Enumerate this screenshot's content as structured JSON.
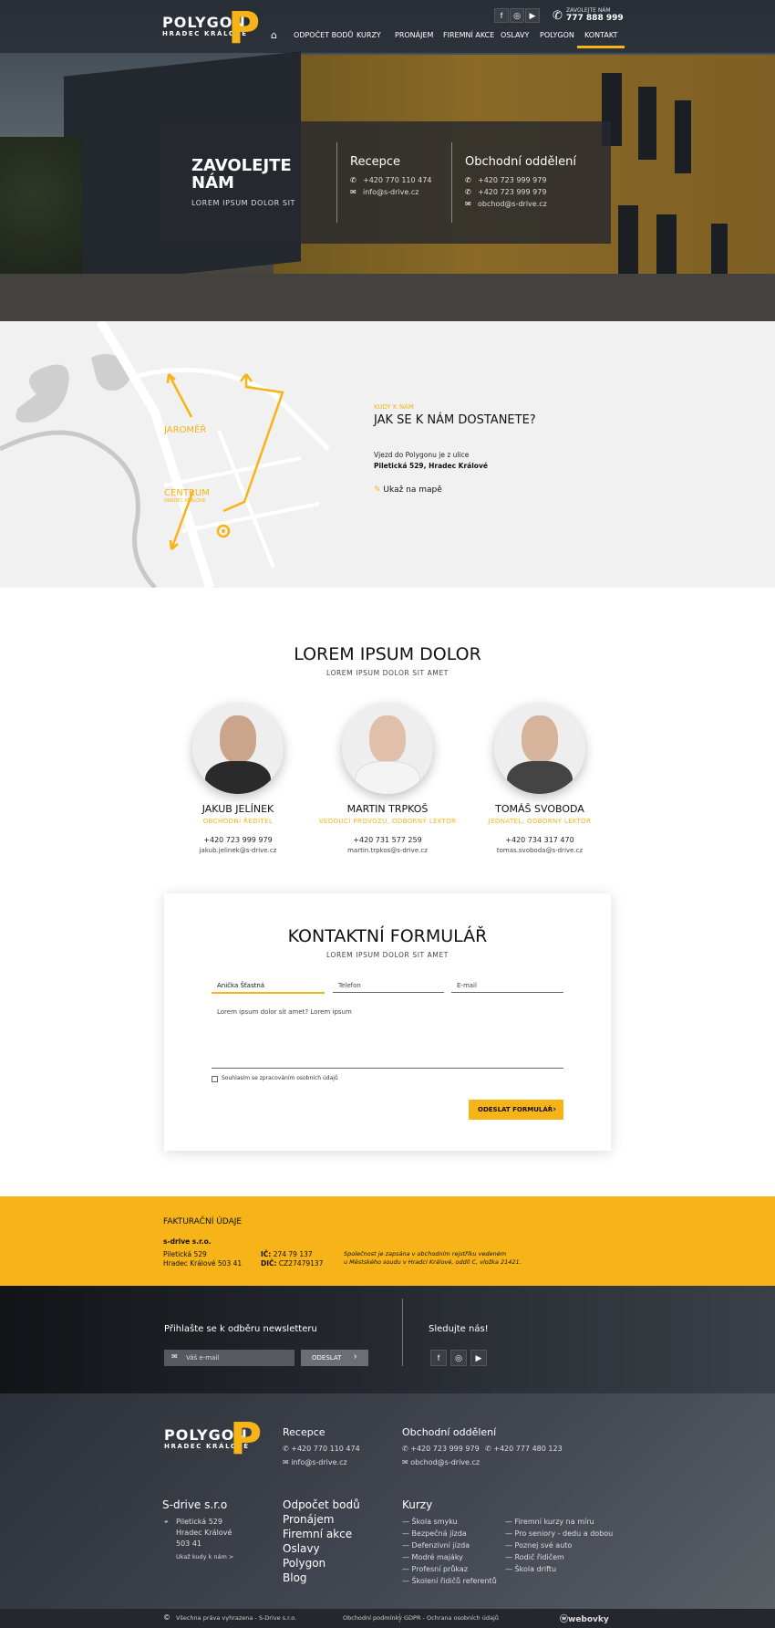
{
  "header": {
    "logo_main": "POLYGON",
    "logo_sub": "HRADEC KRÁLOVÉ",
    "call_label": "ZAVOLEJTE NÁM",
    "call_number": "777 888 999",
    "nav": [
      "ODPOČET BODŮ",
      "KURZY",
      "PRONÁJEM",
      "FIREMNÍ AKCE",
      "OSLAVY",
      "POLYGON",
      "KONTAKT"
    ],
    "social": [
      "facebook-icon",
      "instagram-icon",
      "youtube-icon"
    ]
  },
  "hero": {
    "title": "ZAVOLEJTE NÁM",
    "subtitle": "LOREM IPSUM DOLOR SIT",
    "reception": {
      "heading": "Recepce",
      "phone": "+420 770 110 474",
      "email": "info@s-drive.cz"
    },
    "sales": {
      "heading": "Obchodní oddělení",
      "phone1": "+420 723 999 979",
      "phone2": "+420 723 999 979",
      "email": "obchod@s-drive.cz"
    }
  },
  "map": {
    "label_jaromer": "JAROMĚŘ",
    "label_centrum": "CENTRUM",
    "label_centrum_sub": "HRADEC KRÁLOVÉ",
    "kicker": "KUDY K NÁM",
    "title": "JAK SE K NÁM DOSTANETE?",
    "text": "Vjezd do Polygonu je z ulice",
    "address": "Piletická 529, Hradec Králové",
    "link": "Ukaž na mapě"
  },
  "team": {
    "title": "LOREM IPSUM DOLOR",
    "subtitle": "LOREM IPSUM DOLOR SIT AMET",
    "people": [
      {
        "name": "JAKUB JELÍNEK",
        "role": "OBCHODNÍ ŘEDITEL",
        "phone": "+420 723 999 979",
        "email": "jakub.jelinek@s-drive.cz"
      },
      {
        "name": "MARTIN TRPKOŠ",
        "role": "VEDOUCÍ PROVOZU, ODBORNÝ LEKTOR",
        "phone": "+420 731 577 259",
        "email": "martin.trpkos@s-drive.cz"
      },
      {
        "name": "TOMÁŠ SVOBODA",
        "role": "JEDNATEL, ODBORNÝ LEKTOR",
        "phone": "+420 734 317 470",
        "email": "tomas.svoboda@s-drive.cz"
      }
    ]
  },
  "form": {
    "title": "KONTAKTNÍ FORMULÁŘ",
    "subtitle": "LOREM IPSUM DOLOR SIT AMET",
    "name_value": "Anička Šťastná",
    "phone_placeholder": "Telefon",
    "email_placeholder": "E-mail",
    "message_value": "Lorem ipsum dolor sit amet? Lorem ipsum",
    "consent": "Souhlasím se zpracováním osobních údajů",
    "submit": "ODESLAT FORMULÁŘ"
  },
  "billing": {
    "heading": "FAKTURAČNÍ ÚDAJE",
    "company": "s-drive s.r.o.",
    "street": "Piletická 529",
    "city": "Hradec Králové 503 41",
    "ic_label": "IČ:",
    "ic": "274 79 137",
    "dic_label": "DIČ:",
    "dic": "CZ27479137",
    "reg_line1": "Společnost je zapsána v obchodním rejstříku vedeném",
    "reg_line2": "u Městského soudu v Hradci Králové, oddíl C, vložka 21421."
  },
  "newsletter": {
    "title": "Přihlašte se k odběru newsletteru",
    "placeholder": "Váš e-mail",
    "button": "ODESLAT",
    "follow": "Sledujte nás!"
  },
  "footer": {
    "reception_heading": "Recepce",
    "reception_phone": "+420 770 110 474",
    "reception_email": "info@s-drive.cz",
    "sales_heading": "Obchodní oddělení",
    "sales_phone1": "+420 723 999 979",
    "sales_phone2": "+420 777 480 123",
    "sales_email": "obchod@s-drive.cz",
    "company": "S-drive s.r.o",
    "addr1": "Piletická 529",
    "addr2": "Hradec Králové",
    "addr3": "503 41",
    "route_link": "Ukaž kudy k nám >",
    "menu": [
      "Odpočet bodů",
      "Pronájem",
      "Firemní akce",
      "Oslavy",
      "Polygon",
      "Blog"
    ],
    "courses_heading": "Kurzy",
    "courses_col1": [
      "Škola smyku",
      "Bezpečná jízda",
      "Defenzivní jízda",
      "Modré majáky",
      "Profesní průkaz",
      "Školení řidičů referentů"
    ],
    "courses_col2": [
      "Firemní kurzy na míru",
      "Pro seniory - dedu a dobou",
      "Poznej své auto",
      "Rodič řidičem",
      "Škola driftu"
    ]
  },
  "bottom": {
    "rights": "Všechna práva vyhrazena - S-Drive s.r.o.",
    "terms": "Obchodní podmínky",
    "gdpr": "GDPR - Ochrana osobních údajů",
    "agency": "webovky"
  },
  "colors": {
    "accent": "#f6b418",
    "dark": "#24272d"
  }
}
